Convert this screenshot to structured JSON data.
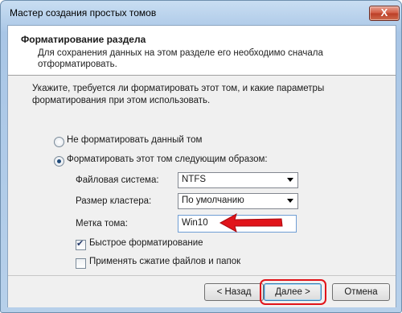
{
  "window": {
    "title": "Мастер создания простых томов",
    "close_glyph": "X"
  },
  "header": {
    "title": "Форматирование раздела",
    "subtitle": "Для сохранения данных на этом разделе его необходимо сначала отформатировать."
  },
  "question": "Укажите, требуется ли форматировать этот том, и какие параметры форматирования при этом использовать.",
  "options": {
    "no_format": {
      "label": "Не форматировать данный том",
      "checked": false
    },
    "format": {
      "label": "Форматировать этот том следующим образом:",
      "checked": true
    }
  },
  "fields": {
    "filesystem": {
      "label": "Файловая система:",
      "value": "NTFS"
    },
    "cluster": {
      "label": "Размер кластера:",
      "value": "По умолчанию"
    },
    "volume_label": {
      "label": "Метка тома:",
      "value": "Win10"
    }
  },
  "checkboxes": {
    "quick": {
      "label": "Быстрое форматирование",
      "checked": true
    },
    "compress": {
      "label": "Применять сжатие файлов и папок",
      "checked": false
    }
  },
  "buttons": {
    "back": "< Назад",
    "next": "Далее >",
    "cancel": "Отмена"
  },
  "colors": {
    "annotation": "#e1141a",
    "title_bar": "#b7d0ea"
  },
  "annotations": {
    "arrow_icon": "red-arrow-icon",
    "highlight": "next-button-highlight"
  }
}
